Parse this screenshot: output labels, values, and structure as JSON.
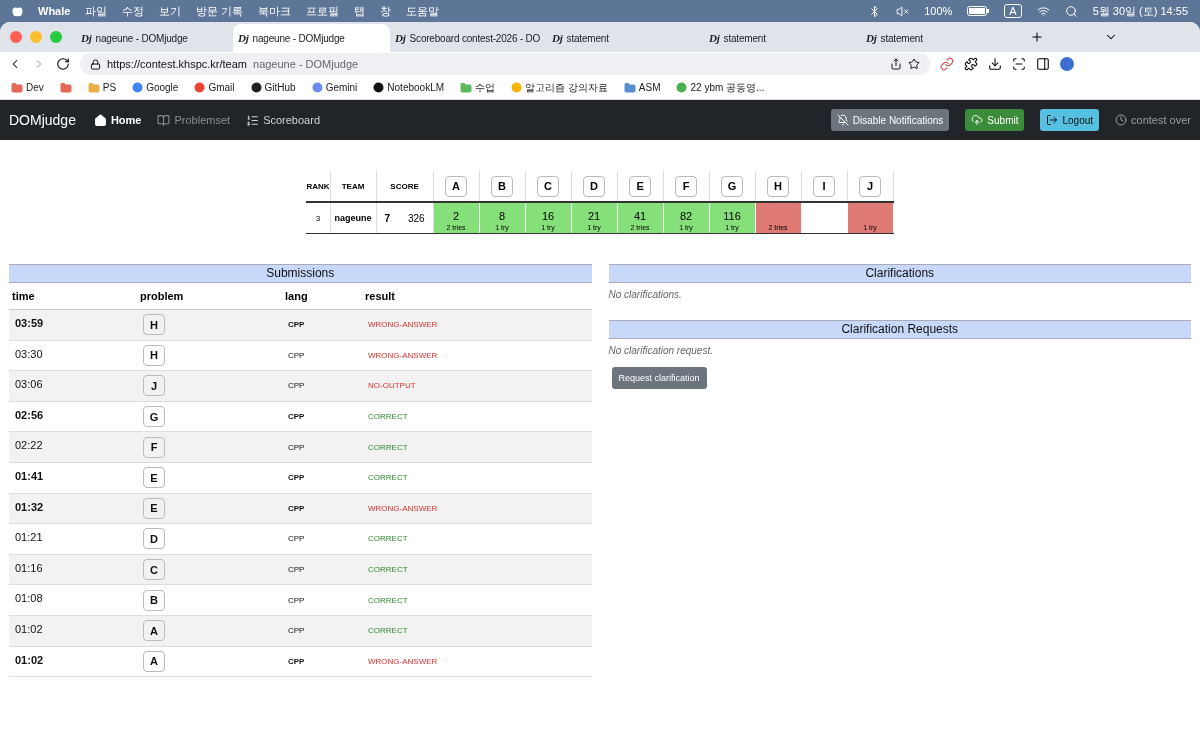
{
  "menu_bar": {
    "app": "Whale",
    "menus": [
      "파일",
      "수정",
      "보기",
      "방문 기록",
      "북마크",
      "프로필",
      "탭",
      "창",
      "도움말"
    ],
    "battery": "100%",
    "input_source": "A",
    "clock": "5월 30일 (토) 14:55"
  },
  "tabs": [
    {
      "favicon": "Dj",
      "title": "nageune - DOMjudge",
      "selected": false
    },
    {
      "favicon": "Dj",
      "title": "nageune - DOMjudge",
      "selected": true
    },
    {
      "favicon": "Dj",
      "title": "Scoreboard contest-2026 - DO",
      "selected": false
    },
    {
      "favicon": "Dj",
      "title": "statement",
      "selected": false
    },
    {
      "favicon": "Dj",
      "title": "statement",
      "selected": false
    },
    {
      "favicon": "Dj",
      "title": "statement",
      "selected": false
    }
  ],
  "address_bar": {
    "url": "https://contest.khspc.kr/team",
    "page_title": "nageune - DOMjudge"
  },
  "bookmarks": [
    {
      "kind": "folder",
      "label": "Dev",
      "color": "#e5675a"
    },
    {
      "kind": "folder",
      "color": "#e5675a"
    },
    {
      "kind": "folder",
      "label": "PS",
      "color": "#e8b04a"
    },
    {
      "kind": "site",
      "label": "Google",
      "color": "#4285f4"
    },
    {
      "kind": "site",
      "label": "Gmail",
      "color": "#ea4335"
    },
    {
      "kind": "site",
      "label": "GitHub",
      "color": "#222222"
    },
    {
      "kind": "site",
      "label": "Gemini",
      "color": "#6a8cf0"
    },
    {
      "kind": "site",
      "label": "NotebookLM",
      "color": "#111111"
    },
    {
      "kind": "folder",
      "label": "수업",
      "color": "#5cb85c"
    },
    {
      "kind": "site",
      "label": "알고리즘 강의자료",
      "color": "#f4b400"
    },
    {
      "kind": "folder",
      "label": "ASM",
      "color": "#5a8fd0"
    },
    {
      "kind": "site",
      "label": "22 ybm 공동영...",
      "color": "#4caf50"
    }
  ],
  "navbar": {
    "brand": "DOMjudge",
    "links": [
      {
        "label": "Home",
        "selected": true,
        "disabled": false
      },
      {
        "label": "Problemset",
        "selected": false,
        "disabled": true
      },
      {
        "label": "Scoreboard",
        "selected": false,
        "disabled": false
      }
    ],
    "buttons": [
      {
        "kind": "notifications",
        "label": "Disable Notifications"
      },
      {
        "kind": "submit",
        "label": "Submit"
      },
      {
        "kind": "logout",
        "label": "Logout"
      }
    ],
    "status": "contest over"
  },
  "scoreboard": {
    "columns": [
      "RANK",
      "TEAM",
      "SCORE"
    ],
    "team": {
      "rank": "3",
      "name": "nageune",
      "solved": "7",
      "penalty": "326"
    },
    "problems": [
      {
        "label": "A",
        "kind": "solved",
        "time": "2",
        "tries": "2 tries"
      },
      {
        "label": "B",
        "kind": "solved",
        "time": "8",
        "tries": "1 try"
      },
      {
        "label": "C",
        "kind": "solved",
        "time": "16",
        "tries": "1 try"
      },
      {
        "label": "D",
        "kind": "solved",
        "time": "21",
        "tries": "1 try"
      },
      {
        "label": "E",
        "kind": "solved",
        "time": "41",
        "tries": "2 tries"
      },
      {
        "label": "F",
        "kind": "solved",
        "time": "82",
        "tries": "1 try"
      },
      {
        "label": "G",
        "kind": "solved",
        "time": "116",
        "tries": "1 try"
      },
      {
        "label": "H",
        "kind": "failed",
        "tries": "2 tries"
      },
      {
        "label": "I",
        "kind": "none"
      },
      {
        "label": "J",
        "kind": "failed",
        "tries": "1 try"
      }
    ]
  },
  "submissions": {
    "title": "Submissions",
    "columns": [
      "time",
      "problem",
      "lang",
      "result"
    ],
    "rows": [
      {
        "time": "03:59",
        "problem": "H",
        "lang": "CPP",
        "result": "WRONG-ANSWER",
        "kind": "wrong",
        "unread": true
      },
      {
        "time": "03:30",
        "problem": "H",
        "lang": "CPP",
        "result": "WRONG-ANSWER",
        "kind": "wrong",
        "unread": false
      },
      {
        "time": "03:06",
        "problem": "J",
        "lang": "CPP",
        "result": "NO-OUTPUT",
        "kind": "wrong",
        "unread": false
      },
      {
        "time": "02:56",
        "problem": "G",
        "lang": "CPP",
        "result": "CORRECT",
        "kind": "correct",
        "unread": true
      },
      {
        "time": "02:22",
        "problem": "F",
        "lang": "CPP",
        "result": "CORRECT",
        "kind": "correct",
        "unread": false
      },
      {
        "time": "01:41",
        "problem": "E",
        "lang": "CPP",
        "result": "CORRECT",
        "kind": "correct",
        "unread": true
      },
      {
        "time": "01:32",
        "problem": "E",
        "lang": "CPP",
        "result": "WRONG-ANSWER",
        "kind": "wrong",
        "unread": true
      },
      {
        "time": "01:21",
        "problem": "D",
        "lang": "CPP",
        "result": "CORRECT",
        "kind": "correct",
        "unread": false
      },
      {
        "time": "01:16",
        "problem": "C",
        "lang": "CPP",
        "result": "CORRECT",
        "kind": "correct",
        "unread": false
      },
      {
        "time": "01:08",
        "problem": "B",
        "lang": "CPP",
        "result": "CORRECT",
        "kind": "correct",
        "unread": false
      },
      {
        "time": "01:02",
        "problem": "A",
        "lang": "CPP",
        "result": "CORRECT",
        "kind": "correct",
        "unread": false
      },
      {
        "time": "01:02",
        "problem": "A",
        "lang": "CPP",
        "result": "WRONG-ANSWER",
        "kind": "wrong",
        "unread": true
      }
    ]
  },
  "clarifications": {
    "title": "Clarifications",
    "empty": "No clarifications."
  },
  "clarification_requests": {
    "title": "Clarification Requests",
    "empty": "No clarification request.",
    "button": "Request clarification"
  }
}
